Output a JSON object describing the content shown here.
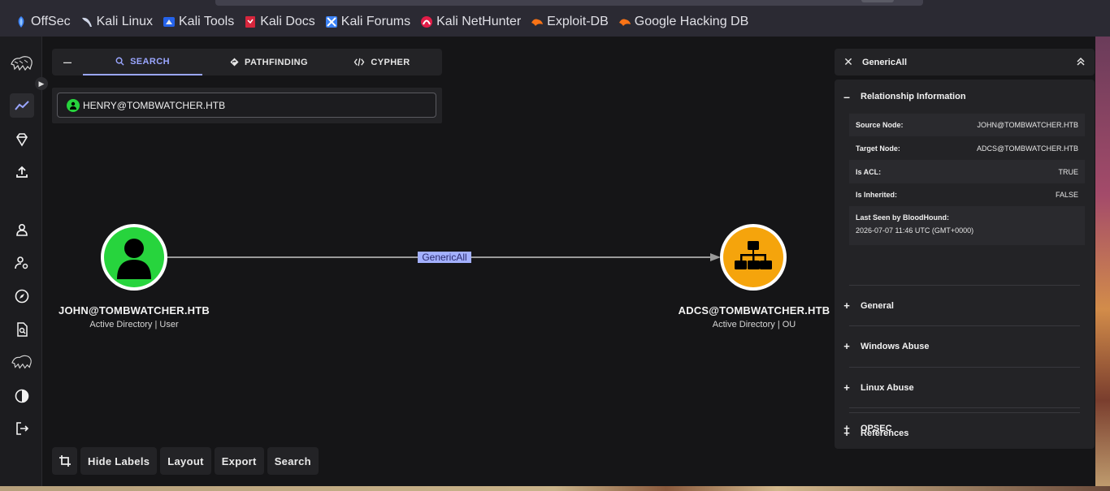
{
  "browser": {
    "bookmarks": [
      {
        "label": "OffSec",
        "icon": "offsec-icon",
        "color": "#3b82f6"
      },
      {
        "label": "Kali Linux",
        "icon": "kali-dragon-icon",
        "color": "#cfd5e6"
      },
      {
        "label": "Kali Tools",
        "icon": "kali-tools-icon",
        "color": "#3b82f6"
      },
      {
        "label": "Kali Docs",
        "icon": "kali-docs-icon",
        "color": "#d7263d"
      },
      {
        "label": "Kali Forums",
        "icon": "kali-forums-icon",
        "color": "#3b82f6"
      },
      {
        "label": "Kali NetHunter",
        "icon": "nethunter-icon",
        "color": "#e11d48"
      },
      {
        "label": "Exploit-DB",
        "icon": "exploitdb-icon",
        "color": "#f97316"
      },
      {
        "label": "Google Hacking DB",
        "icon": "ghdb-icon",
        "color": "#f97316"
      }
    ]
  },
  "search": {
    "tabs": [
      {
        "label": "SEARCH",
        "icon": "search-icon"
      },
      {
        "label": "PATHFINDING",
        "icon": "pathfinding-icon"
      },
      {
        "label": "CYPHER",
        "icon": "code-icon"
      }
    ],
    "query": "HENRY@TOMBWATCHER.HTB"
  },
  "graph": {
    "source": {
      "name": "JOHN@TOMBWATCHER.HTB",
      "kind": "Active Directory | User",
      "color": "#27d43d",
      "icon": "user-icon"
    },
    "target": {
      "name": "ADCS@TOMBWATCHER.HTB",
      "kind": "Active Directory | OU",
      "color": "#f5a40c",
      "icon": "ou-hierarchy-icon"
    },
    "edge_label": "GenericAll"
  },
  "toolbar": {
    "hide_labels": "Hide Labels",
    "layout": "Layout",
    "export": "Export",
    "search": "Search"
  },
  "panel": {
    "title": "GenericAll",
    "relationship_header": "Relationship Information",
    "props": [
      {
        "key": "Source Node:",
        "value": "JOHN@TOMBWATCHER.HTB"
      },
      {
        "key": "Target Node:",
        "value": "ADCS@TOMBWATCHER.HTB"
      },
      {
        "key": "Is ACL:",
        "value": "TRUE"
      },
      {
        "key": "Is Inherited:",
        "value": "FALSE"
      }
    ],
    "last_seen_key": "Last Seen by BloodHound:",
    "last_seen_value": "2026-07-07 11:46 UTC (GMT+0000)",
    "sections": [
      "General",
      "Windows Abuse",
      "Linux Abuse",
      "OPSEC",
      "References"
    ]
  }
}
